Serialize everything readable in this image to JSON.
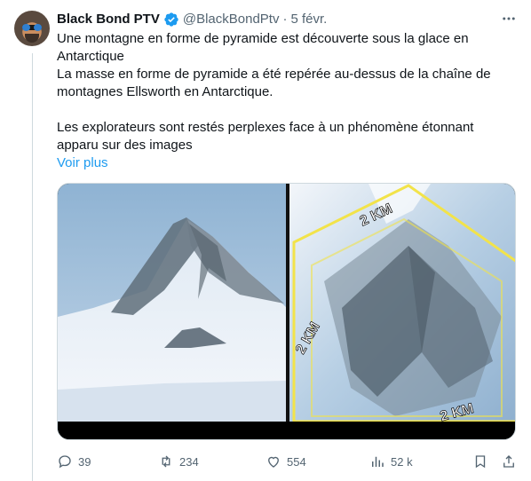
{
  "author": {
    "display_name": "Black Bond PTV",
    "handle": "@BlackBondPtv",
    "separator": "·",
    "date": "5 févr."
  },
  "tweet": {
    "paragraphs": [
      "Une montagne en forme de pyramide est découverte sous la glace en Antarctique",
      "La masse en forme de pyramide a été repérée au-dessus de la chaîne de montagnes Ellsworth en Antarctique.",
      "",
      "Les explorateurs sont restés perplexes face à un phénomène étonnant apparu sur des images"
    ],
    "see_more": "Voir plus"
  },
  "media": {
    "labels": {
      "top": "2 KM",
      "left": "2 KM",
      "bottom": "2 KM"
    }
  },
  "actions": {
    "replies": "39",
    "reposts": "234",
    "likes": "554",
    "views": "52 k"
  },
  "colors": {
    "accent": "#1d9bf0",
    "secondary_text": "#536471",
    "annotation_yellow": "#f2e34a"
  },
  "icons": {
    "verified": "verified-badge-icon",
    "more": "more-dots-icon",
    "reply": "reply-icon",
    "repost": "repost-icon",
    "like": "heart-icon",
    "views": "views-chart-icon",
    "bookmark": "bookmark-icon",
    "share": "share-icon"
  }
}
